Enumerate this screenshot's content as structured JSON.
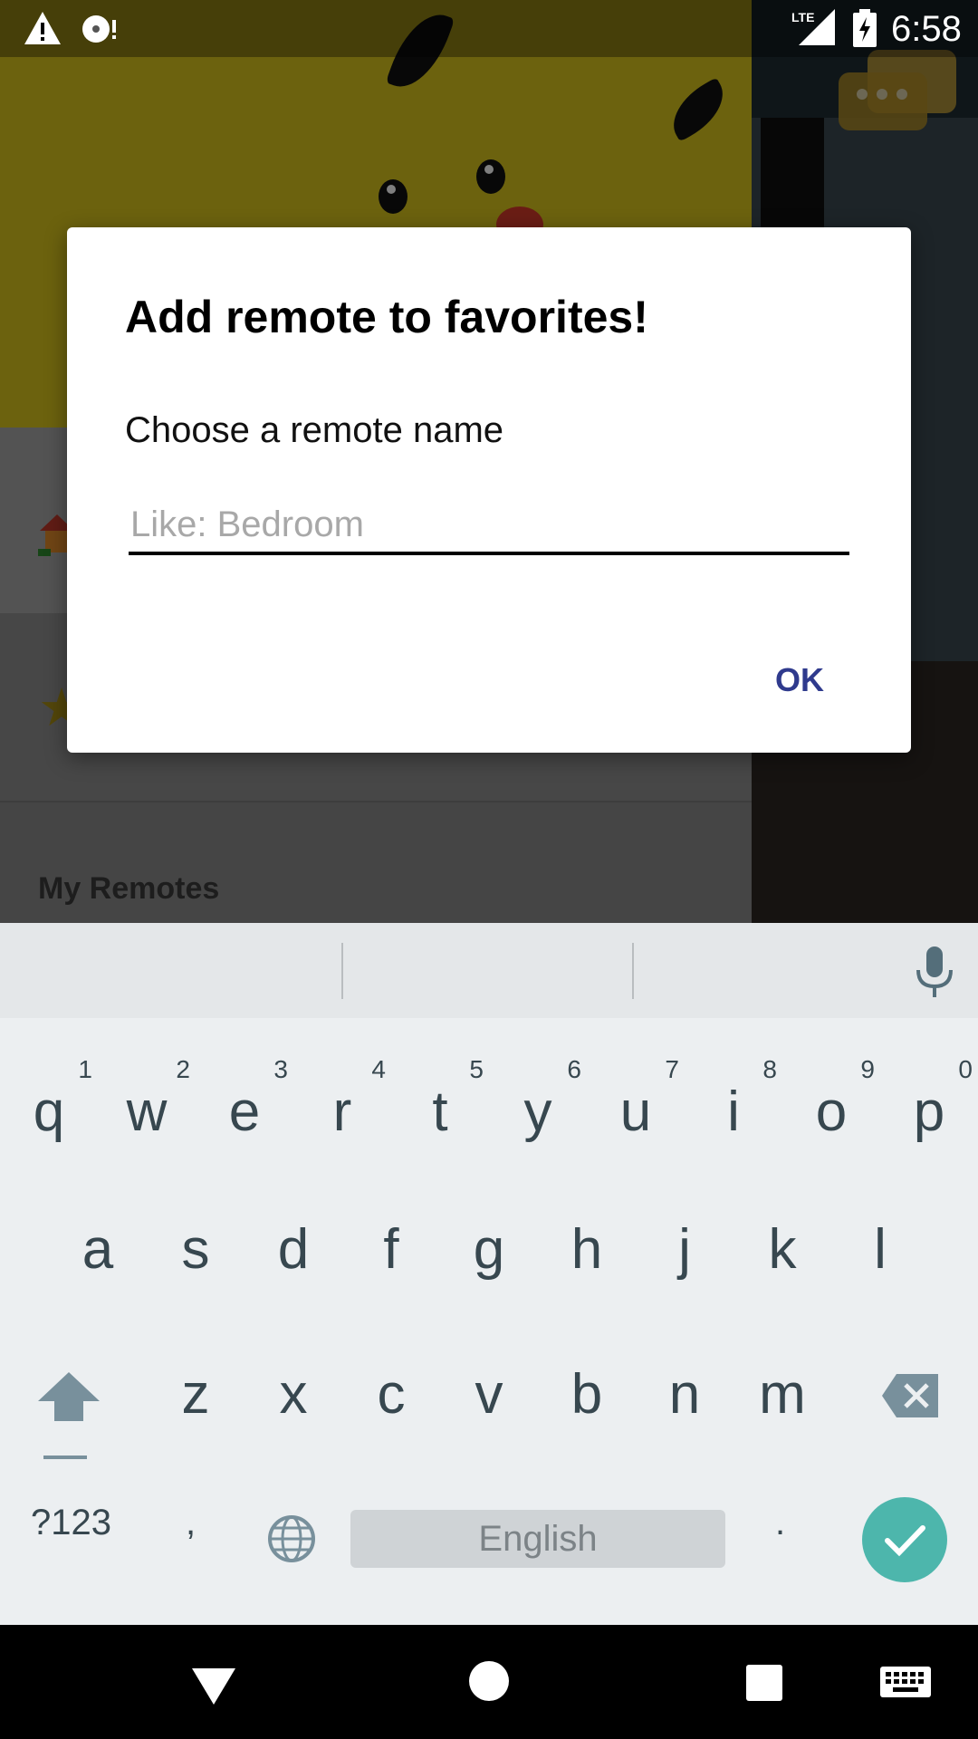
{
  "status_bar": {
    "network": "LTE",
    "time": "6:58"
  },
  "background": {
    "section_header": "My Remotes"
  },
  "dialog": {
    "title": "Add remote to favorites!",
    "subtitle": "Choose a remote name",
    "input_placeholder": "Like: Bedroom",
    "input_value": "",
    "ok_label": "OK"
  },
  "keyboard": {
    "row1": [
      {
        "key": "q",
        "hint": "1"
      },
      {
        "key": "w",
        "hint": "2"
      },
      {
        "key": "e",
        "hint": "3"
      },
      {
        "key": "r",
        "hint": "4"
      },
      {
        "key": "t",
        "hint": "5"
      },
      {
        "key": "y",
        "hint": "6"
      },
      {
        "key": "u",
        "hint": "7"
      },
      {
        "key": "i",
        "hint": "8"
      },
      {
        "key": "o",
        "hint": "9"
      },
      {
        "key": "p",
        "hint": "0"
      }
    ],
    "row2": [
      "a",
      "s",
      "d",
      "f",
      "g",
      "h",
      "j",
      "k",
      "l"
    ],
    "row3": [
      "z",
      "x",
      "c",
      "v",
      "b",
      "n",
      "m"
    ],
    "symbols_label": "?123",
    "comma_label": ",",
    "space_label": "English",
    "period_label": ".",
    "enter_color": "#4db6ac"
  },
  "colors": {
    "accent": "#2f3a8d",
    "keyboard_bg": "#eceff1",
    "key_text": "#37474f"
  }
}
